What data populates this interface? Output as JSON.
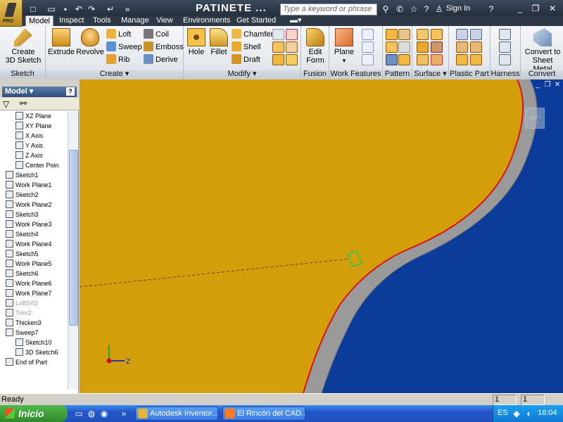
{
  "app": {
    "product_badge": "PRO",
    "document_title": "PATINETE ...",
    "search_placeholder": "Type a keyword or phrase",
    "sign_in": "Sign In"
  },
  "tabs": [
    "Model",
    "Inspect",
    "Tools",
    "Manage",
    "View",
    "Environments",
    "Get Started"
  ],
  "active_tab": "Model",
  "ribbon": {
    "sketch": {
      "label": "Sketch",
      "create_3d_sketch": "Create\n3D Sketch"
    },
    "create": {
      "label": "Create",
      "extrude": "Extrude",
      "revolve": "Revolve",
      "loft": "Loft",
      "sweep": "Sweep",
      "rib": "Rib",
      "coil": "Coil",
      "emboss": "Emboss",
      "derive": "Derive"
    },
    "modify": {
      "label": "Modify",
      "hole": "Hole",
      "fillet": "Fillet",
      "chamfer": "Chamfer",
      "shell": "Shell",
      "draft": "Draft"
    },
    "fusion": {
      "label": "Fusion",
      "edit_form": "Edit\nForm"
    },
    "work_features": {
      "label": "Work Features",
      "plane": "Plane"
    },
    "pattern": {
      "label": "Pattern"
    },
    "surface": {
      "label": "Surface"
    },
    "plastic_part": {
      "label": "Plastic Part"
    },
    "harness": {
      "label": "Harness"
    },
    "convert": {
      "label": "Convert",
      "convert_to_sheet_metal": "Convert to\nSheet Metal"
    }
  },
  "browser": {
    "title": "Model",
    "items": [
      {
        "label": "XZ Plane",
        "level": 2,
        "dim": false
      },
      {
        "label": "XY Plane",
        "level": 2,
        "dim": false
      },
      {
        "label": "X Axis",
        "level": 2,
        "dim": false
      },
      {
        "label": "Y Axis",
        "level": 2,
        "dim": false
      },
      {
        "label": "Z Axis",
        "level": 2,
        "dim": false
      },
      {
        "label": "Center Poin",
        "level": 2,
        "dim": false
      },
      {
        "label": "Sketch1",
        "level": 1,
        "dim": false
      },
      {
        "label": "Work Plane1",
        "level": 1,
        "dim": false
      },
      {
        "label": "Sketch2",
        "level": 1,
        "dim": false
      },
      {
        "label": "Work Plane2",
        "level": 1,
        "dim": false
      },
      {
        "label": "Sketch3",
        "level": 1,
        "dim": false
      },
      {
        "label": "Work Plane3",
        "level": 1,
        "dim": false
      },
      {
        "label": "Sketch4",
        "level": 1,
        "dim": false
      },
      {
        "label": "Work Plane4",
        "level": 1,
        "dim": false
      },
      {
        "label": "Sketch5",
        "level": 1,
        "dim": false
      },
      {
        "label": "Work Plane5",
        "level": 1,
        "dim": false
      },
      {
        "label": "Sketch6",
        "level": 1,
        "dim": false
      },
      {
        "label": "Work Plane6",
        "level": 1,
        "dim": false
      },
      {
        "label": "Work Plane7",
        "level": 1,
        "dim": false
      },
      {
        "label": "LoftSrf2",
        "level": 1,
        "dim": true
      },
      {
        "label": "Trim2",
        "level": 1,
        "dim": true
      },
      {
        "label": "Thicken3",
        "level": 1,
        "dim": false
      },
      {
        "label": "Sweep7",
        "level": 1,
        "dim": false
      },
      {
        "label": "Sketch10",
        "level": 2,
        "dim": false
      },
      {
        "label": "3D Sketch6",
        "level": 2,
        "dim": false
      },
      {
        "label": "End of Part",
        "level": 1,
        "dim": false
      }
    ]
  },
  "viewport": {
    "viewcube_label": "LEFT",
    "axis_x": "Z",
    "colors": {
      "background": "#0b3c9c",
      "face": "#d39e0a",
      "edge": "#dd1111",
      "side": "#9a9a9a"
    }
  },
  "status": {
    "text": "Ready",
    "cell1": "1",
    "cell2": "1"
  },
  "taskbar": {
    "start": "Inicio",
    "items": [
      "Autodesk Inventor...",
      "El Rincón del CAD..."
    ],
    "language": "ES",
    "clock": "16:04"
  }
}
